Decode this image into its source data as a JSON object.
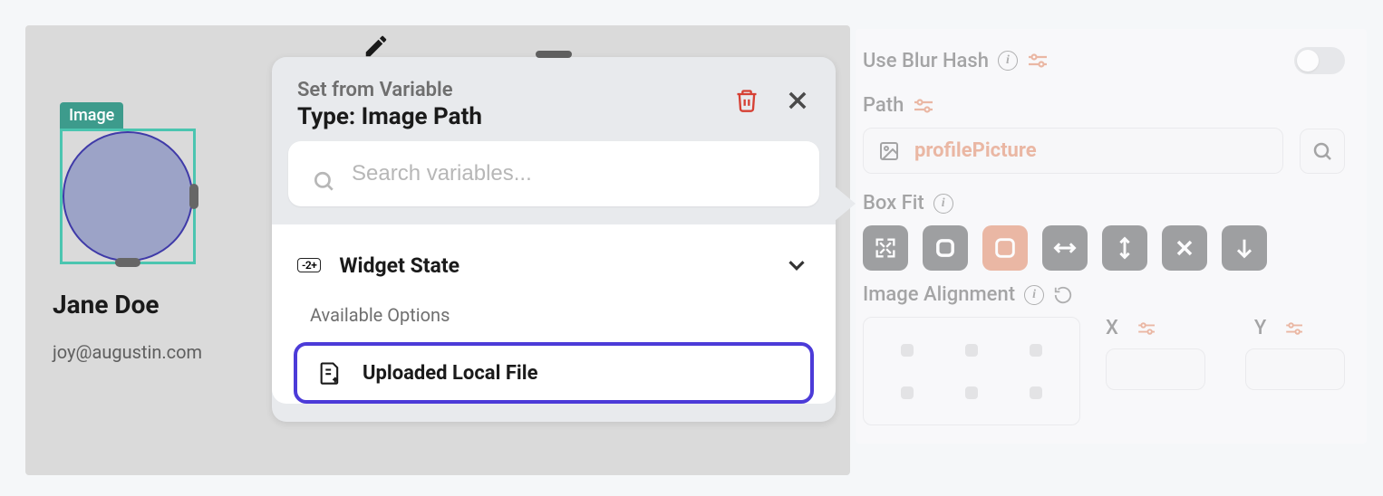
{
  "canvas": {
    "image_badge": "Image",
    "profile_name": "Jane Doe",
    "profile_email": "joy@augustin.com"
  },
  "popup": {
    "subtitle": "Set from Variable",
    "title": "Type: Image Path",
    "search_placeholder": "Search variables...",
    "section_badge": "-2+",
    "section_title": "Widget State",
    "available_label": "Available Options",
    "option_uploaded": "Uploaded Local File"
  },
  "panel": {
    "use_blur_hash": "Use Blur Hash",
    "path_label": "Path",
    "path_value": "profilePicture",
    "box_fit": "Box Fit",
    "image_alignment": "Image Alignment",
    "x_label": "X",
    "y_label": "Y"
  }
}
